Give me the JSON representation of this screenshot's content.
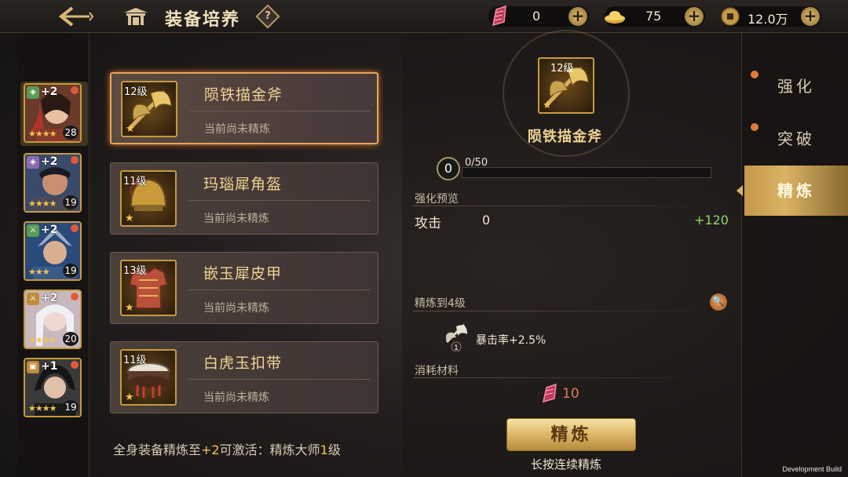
{
  "header": {
    "title": "装备培养",
    "help_label": "?",
    "resources": [
      {
        "name": "refine-stone",
        "value": "0",
        "color": "#c0385a"
      },
      {
        "name": "gold-ingot",
        "value": "75",
        "color": "#e8c04a"
      },
      {
        "name": "copper-coin",
        "value": "12.0万",
        "color": "#b08a4a"
      }
    ],
    "plus_label": "+"
  },
  "heroes": [
    {
      "plus": "+2",
      "level": "28",
      "stars": "★★★★",
      "badge_color": "#5a9b55",
      "selected": true
    },
    {
      "plus": "+2",
      "level": "19",
      "stars": "★★★★",
      "badge_color": "#8a6ab5",
      "selected": false
    },
    {
      "plus": "+2",
      "level": "19",
      "stars": "★★★",
      "badge_color": "#5a9b55",
      "selected": false
    },
    {
      "plus": "+2",
      "level": "20",
      "stars": "★★★★",
      "badge_color": "#c08a3a",
      "selected": false
    },
    {
      "plus": "+1",
      "level": "19",
      "stars": "★★★★",
      "badge_color": "#c08a3a",
      "selected": false
    }
  ],
  "equipment": [
    {
      "level": "12级",
      "name": "陨铁描金斧",
      "status": "当前尚未精炼",
      "selected": true
    },
    {
      "level": "11级",
      "name": "玛瑙犀角盔",
      "status": "当前尚未精炼",
      "selected": false
    },
    {
      "level": "13级",
      "name": "嵌玉犀皮甲",
      "status": "当前尚未精炼",
      "selected": false
    },
    {
      "level": "11级",
      "name": "白虎玉扣带",
      "status": "当前尚未精炼",
      "selected": false
    }
  ],
  "footer": {
    "prefix": "全身装备精炼至",
    "plus": "+2",
    "middle": "可激活：精炼大师",
    "level": "1",
    "suffix": "级"
  },
  "detail": {
    "level": "12级",
    "name": "陨铁描金斧",
    "refine_level": "0",
    "progress_text": "0/50",
    "progress_fraction": 0,
    "preview_label": "强化预览",
    "attr_name": "攻击",
    "attr_value": "0",
    "attr_bonus": "+120",
    "refine_to_label": "精炼到4级",
    "crit_count": "1",
    "crit_text": "暴击率+2.5%",
    "materials_label": "消耗材料",
    "material_cost": "10",
    "refine_button": "精炼",
    "refine_hint": "长按连续精炼"
  },
  "tabs": [
    {
      "label": "强化",
      "dot": true,
      "active": false
    },
    {
      "label": "突破",
      "dot": true,
      "active": false
    },
    {
      "label": "精炼",
      "dot": false,
      "active": true
    }
  ],
  "build_label": "Development Build"
}
